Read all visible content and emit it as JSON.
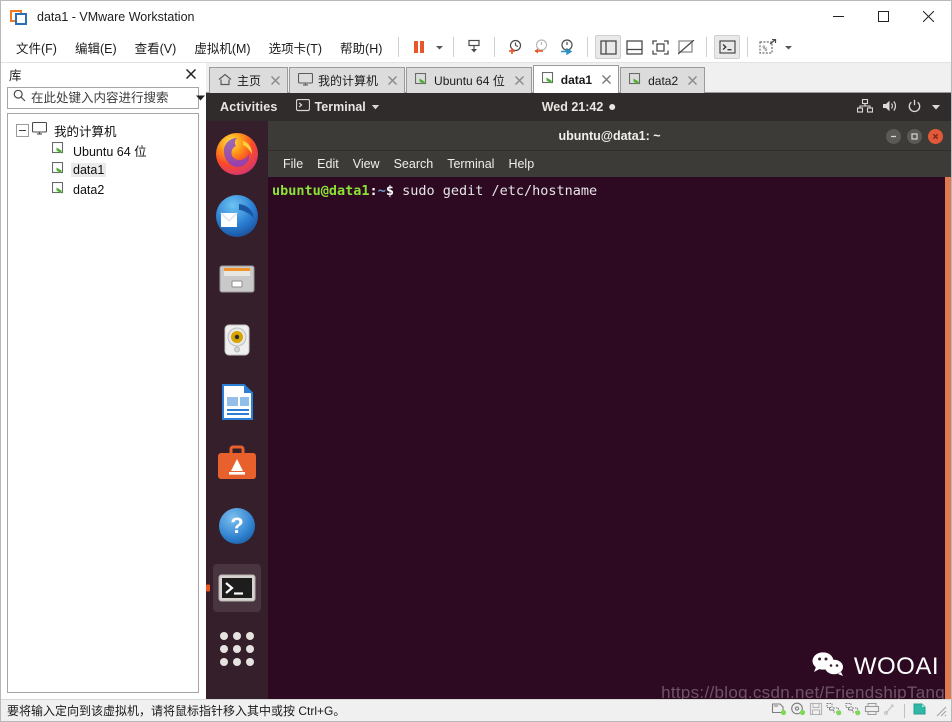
{
  "window": {
    "title": "data1 - VMware Workstation",
    "app_icon": "vmware-logo-icon",
    "minimize_label": "最小化",
    "maximize_label": "最大化",
    "close_label": "关闭"
  },
  "menubar": {
    "items": [
      {
        "label": "文件(F)",
        "mnemonic": "F",
        "name": "menu-file"
      },
      {
        "label": "编辑(E)",
        "mnemonic": "E",
        "name": "menu-edit"
      },
      {
        "label": "查看(V)",
        "mnemonic": "V",
        "name": "menu-view"
      },
      {
        "label": "虚拟机(M)",
        "mnemonic": "M",
        "name": "menu-vm"
      },
      {
        "label": "选项卡(T)",
        "mnemonic": "T",
        "name": "menu-tabs"
      },
      {
        "label": "帮助(H)",
        "mnemonic": "H",
        "name": "menu-help"
      }
    ]
  },
  "toolbar": {
    "buttons": [
      {
        "name": "suspend-button",
        "icon": "pause-icon",
        "title": "挂起"
      },
      {
        "name": "power-dropdown",
        "icon": "chevron-down-icon",
        "title": "电源选项"
      },
      {
        "name": "manage-snapshot-button",
        "icon": "snapshot-manager-icon",
        "title": "管理快照"
      },
      {
        "name": "take-snapshot-button",
        "icon": "snapshot-take-icon",
        "title": "拍摄快照"
      },
      {
        "name": "revert-snapshot-button",
        "icon": "snapshot-revert-icon",
        "title": "恢复快照"
      },
      {
        "name": "snapshot-manager-button",
        "icon": "snapshot-settings-icon",
        "title": "快照管理器"
      },
      {
        "name": "show-library-button",
        "icon": "panel-left-icon",
        "title": "显示或隐藏库"
      },
      {
        "name": "show-console-button",
        "icon": "panel-bottom-icon",
        "title": "显示或隐藏控制台视图"
      },
      {
        "name": "fullscreen-button",
        "icon": "fullscreen-icon",
        "title": "进入全屏"
      },
      {
        "name": "unity-button",
        "icon": "unity-mode-icon",
        "title": "Unity 模式"
      },
      {
        "name": "console-view-button",
        "icon": "terminal-icon",
        "title": "控制台视图"
      },
      {
        "name": "send-key-button",
        "icon": "send-key-icon",
        "title": "发送组合键"
      }
    ]
  },
  "sidebar": {
    "title": "库",
    "close_icon": "close-icon",
    "search": {
      "placeholder": "在此处键入内容进行搜索",
      "value": "",
      "icon": "search-icon",
      "dropdown_icon": "chevron-down-icon"
    },
    "tree": {
      "root": {
        "label": "我的计算机",
        "icon": "computer-icon",
        "expanded": true
      },
      "children": [
        {
          "label": "Ubuntu 64 位",
          "icon": "vm-icon",
          "selected": false
        },
        {
          "label": "data1",
          "icon": "vm-icon",
          "selected": true
        },
        {
          "label": "data2",
          "icon": "vm-icon",
          "selected": false
        }
      ]
    }
  },
  "tabs": [
    {
      "label": "主页",
      "icon": "home-icon",
      "active": false,
      "name": "tab-home"
    },
    {
      "label": "我的计算机",
      "icon": "computer-icon",
      "active": false,
      "name": "tab-my-computer"
    },
    {
      "label": "Ubuntu 64 位",
      "icon": "vm-icon",
      "active": false,
      "name": "tab-ubuntu-64"
    },
    {
      "label": "data1",
      "icon": "vm-icon",
      "active": true,
      "name": "tab-data1"
    },
    {
      "label": "data2",
      "icon": "vm-icon",
      "active": false,
      "name": "tab-data2"
    }
  ],
  "guest": {
    "topbar": {
      "activities": "Activities",
      "app_name": "Terminal",
      "app_icon": "terminal-icon",
      "app_dropdown_icon": "chevron-down-icon",
      "clock": "Wed 21:42",
      "notification_dot": true,
      "status_icons": [
        {
          "name": "network-icon",
          "label": "网络"
        },
        {
          "name": "volume-icon",
          "label": "音量"
        },
        {
          "name": "power-icon",
          "label": "电源"
        },
        {
          "name": "chevron-down-icon",
          "label": "系统菜单"
        }
      ]
    },
    "dock": {
      "items": [
        {
          "name": "dock-item-firefox",
          "label": "Firefox",
          "active": false
        },
        {
          "name": "dock-item-thunderbird",
          "label": "Thunderbird Mail",
          "active": false
        },
        {
          "name": "dock-item-files",
          "label": "Files",
          "active": false
        },
        {
          "name": "dock-item-rhythmbox",
          "label": "Rhythmbox",
          "active": false
        },
        {
          "name": "dock-item-libreoffice-writer",
          "label": "LibreOffice Writer",
          "active": false
        },
        {
          "name": "dock-item-ubuntu-software",
          "label": "Ubuntu Software",
          "active": false
        },
        {
          "name": "dock-item-help",
          "label": "Help",
          "active": false
        },
        {
          "name": "dock-item-terminal",
          "label": "Terminal",
          "active": true
        }
      ],
      "show_apps_label": "Show Applications"
    },
    "terminal": {
      "title": "ubuntu@data1: ~",
      "controls": {
        "minimize_icon": "minimize-icon",
        "maximize_icon": "maximize-icon",
        "close_icon": "close-icon"
      },
      "menu": [
        "File",
        "Edit",
        "View",
        "Search",
        "Terminal",
        "Help"
      ],
      "prompt": {
        "user_host": "ubuntu@data1",
        "separator": ":",
        "path": "~",
        "sigil": "$"
      },
      "command": "sudo gedit /etc/hostname",
      "colors": {
        "background": "#2d0922",
        "prompt_user": "#8ae234",
        "prompt_path": "#729fcf",
        "text": "#e6e6e6",
        "scrollbar": "#e07a50"
      }
    }
  },
  "watermark": {
    "brand": "WOOAI",
    "icon": "wechat-icon",
    "url": "https://blog.csdn.net/FriendshipTang"
  },
  "statusbar": {
    "message": "要将输入定向到该虚拟机，请将鼠标指针移入其中或按 Ctrl+G。",
    "devices": [
      {
        "name": "status-hard-disk-icon",
        "label": "硬盘"
      },
      {
        "name": "status-cd-dvd-icon",
        "label": "CD/DVD"
      },
      {
        "name": "status-floppy-icon",
        "label": "软盘"
      },
      {
        "name": "status-network-1-icon",
        "label": "网络适配器"
      },
      {
        "name": "status-network-2-icon",
        "label": "网络适配器 2"
      },
      {
        "name": "status-printer-icon",
        "label": "打印机"
      },
      {
        "name": "status-usb-icon",
        "label": "USB 设备"
      },
      {
        "name": "status-display-icon",
        "label": "显示器"
      }
    ],
    "resize_grip_icon": "resize-grip-icon"
  }
}
